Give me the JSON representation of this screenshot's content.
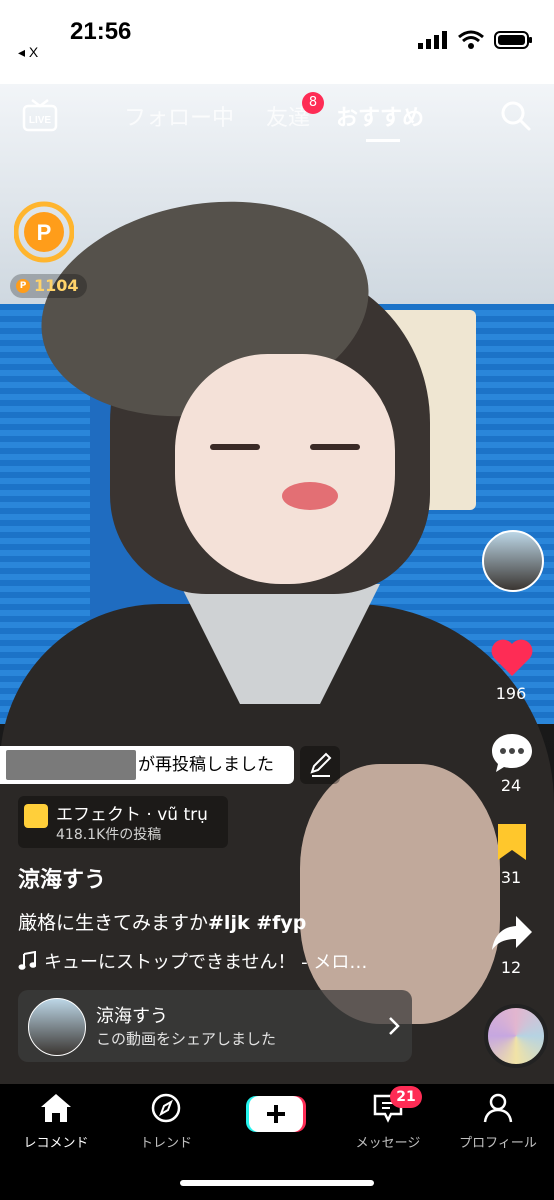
{
  "status": {
    "time": "21:56",
    "back_label": "◂ X"
  },
  "nav": {
    "tabs": [
      {
        "label": "フォロー中",
        "active": false
      },
      {
        "label": "友達",
        "active": false,
        "badge": "8"
      },
      {
        "label": "おすすめ",
        "active": true
      }
    ],
    "live_label": "LIVE"
  },
  "coins": {
    "count": "1104",
    "symbol": "P"
  },
  "actions": {
    "likes": "196",
    "comments": "24",
    "saves": "31",
    "shares": "12"
  },
  "repost": {
    "text": "が再投稿しました"
  },
  "effect": {
    "title": "エフェクト · vũ trụ",
    "count": "418.1K件の投稿"
  },
  "video": {
    "author": "涼海すう",
    "caption_text": "厳格に生きてみますか",
    "caption_tags": "#ljk #fyp",
    "music": "キューにストップできません！ - メロ…"
  },
  "share_card": {
    "name": "涼海すう",
    "subtitle": "この動画をシェアしました"
  },
  "tabbar": {
    "items": [
      {
        "label": "レコメンド",
        "icon": "home-icon",
        "active": true
      },
      {
        "label": "トレンド",
        "icon": "compass-icon",
        "active": false
      },
      {
        "label": "",
        "icon": "create-icon",
        "active": false
      },
      {
        "label": "メッセージ",
        "icon": "inbox-icon",
        "active": false,
        "badge": "21"
      },
      {
        "label": "プロフィール",
        "icon": "profile-icon",
        "active": false
      }
    ]
  },
  "colors": {
    "accent": "#fe2c55",
    "save": "#ffc72c",
    "coin": "#ff9d1a"
  }
}
